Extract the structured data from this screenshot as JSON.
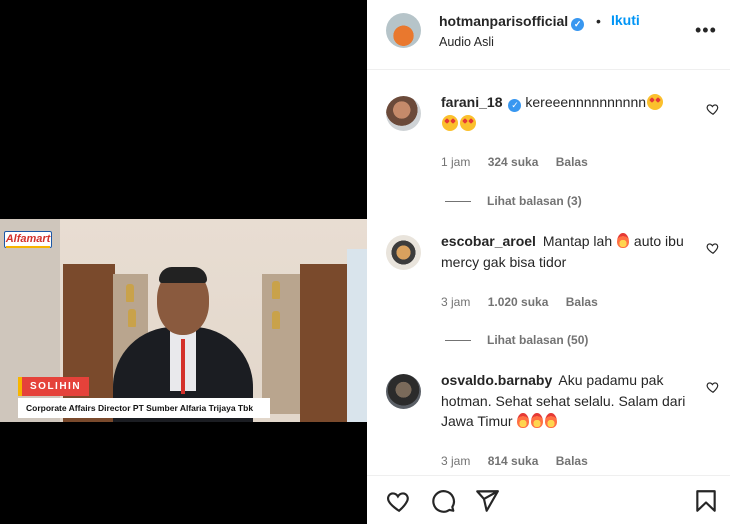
{
  "video": {
    "brand_logo": "Alfamart",
    "lower_third_name": "SOLIHIN",
    "lower_third_title": "Corporate Affairs Director PT Sumber Alfaria Trijaya Tbk"
  },
  "header": {
    "username": "hotmanparisofficial",
    "separator": "•",
    "follow_label": "Ikuti",
    "audio": "Audio Asli",
    "more_label": "•••"
  },
  "comments": [
    {
      "username": "farani_18",
      "verified": true,
      "text": "kereeennnnnnnnnn",
      "time": "1 jam",
      "likes": "324 suka",
      "reply_label": "Balas",
      "view_replies": "Lihat balasan (3)"
    },
    {
      "username": "escobar_aroel",
      "verified": false,
      "text_before": "Mantap lah",
      "text_after": "auto ibu mercy gak bisa tidor",
      "time": "3 jam",
      "likes": "1.020 suka",
      "reply_label": "Balas",
      "view_replies": "Lihat balasan (50)"
    },
    {
      "username": "osvaldo.barnaby",
      "verified": false,
      "text": "Aku padamu pak hotman. Sehat sehat selalu. Salam dari Jawa Timur",
      "time": "3 jam",
      "likes": "814 suka",
      "reply_label": "Balas"
    }
  ],
  "colors": {
    "accent": "#0095f6",
    "verified": "#3897f0",
    "muted": "#737373",
    "lower_third": "#e5423a"
  },
  "icons": [
    "heart-icon",
    "comment-icon",
    "share-icon",
    "bookmark-icon",
    "verified-icon",
    "more-icon"
  ]
}
